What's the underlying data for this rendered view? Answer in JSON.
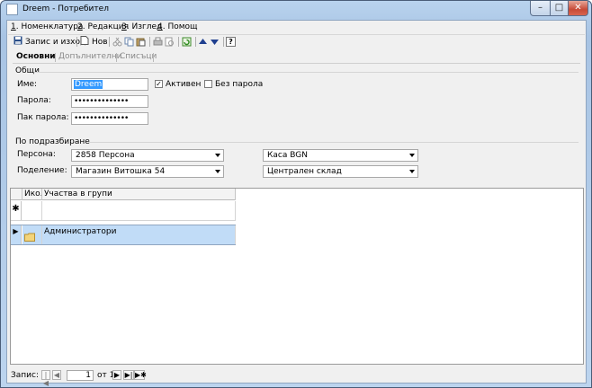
{
  "window": {
    "title": "Dreem - Потребител",
    "min": "–",
    "max": "□",
    "close": "✕"
  },
  "menu": [
    {
      "key": "1",
      "label": ". Номенклатура"
    },
    {
      "key": "2",
      "label": ". Редакция"
    },
    {
      "key": "3",
      "label": ". Изглед"
    },
    {
      "key": "4",
      "label": ". Помощ"
    }
  ],
  "toolbar": {
    "save_exit": "Запис и изход",
    "new": "Нов",
    "help": "?"
  },
  "tabs": [
    "Основни",
    "Допълнителни",
    "Списъци"
  ],
  "general": {
    "group_label": "Общи",
    "name_label": "Име:",
    "name_value": "Dreem",
    "active_label": "Активен",
    "active_checked": true,
    "no_password_label": "Без парола",
    "no_password_checked": false,
    "password_label": "Парола:",
    "password_value": "••••••••••••••",
    "password_repeat_label": "Пак парола:",
    "password_repeat_value": "••••••••••••••"
  },
  "defaults": {
    "group_label": "По подразбиране",
    "persona_label": "Персона:",
    "persona_value": "2858 Персона",
    "division_label": "Поделение:",
    "division_value": "Магазин Витошка 54",
    "cash_value": "Каса BGN",
    "warehouse_value": "Централен склад"
  },
  "grid": {
    "columns": [
      "Ико...",
      "Участва в групи"
    ],
    "new_row_marker": "✱",
    "current_row_marker": "▶",
    "rows": [
      {
        "name": "Администратори"
      }
    ]
  },
  "navigator": {
    "label": "Запис:",
    "first": "|◀",
    "prev": "◀",
    "current": "1",
    "of_label": "от 1",
    "next": "▶",
    "last": "▶|",
    "new": "▶✱"
  },
  "colors": {
    "selection": "#c1dcf7",
    "accent": "#3399ff"
  }
}
